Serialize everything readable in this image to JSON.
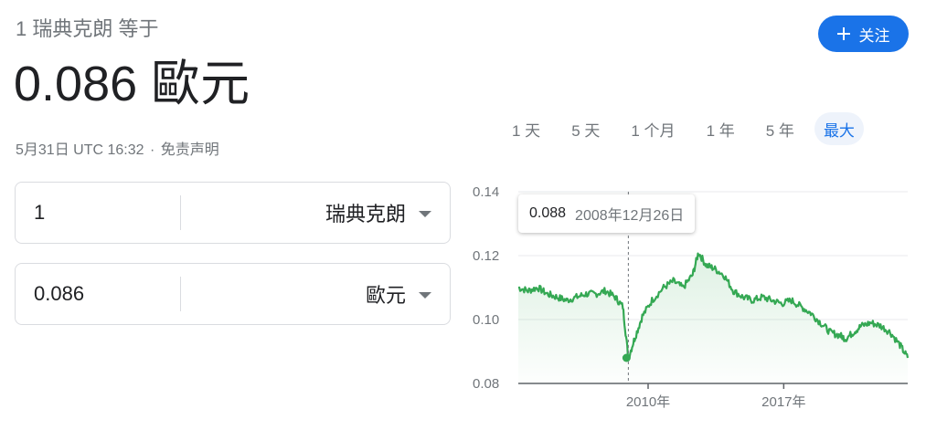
{
  "header": {
    "equals_text": "1 瑞典克朗 等于",
    "big_value": "0.086 歐元",
    "date_text": "5月31日 UTC 16:32",
    "separator": "·",
    "disclaimer": "免责声明"
  },
  "follow_button": {
    "label": "关注",
    "icon": "plus-icon"
  },
  "range_tabs": [
    {
      "label": "1 天"
    },
    {
      "label": "5 天"
    },
    {
      "label": "1 个月"
    },
    {
      "label": "1 年"
    },
    {
      "label": "5 年"
    },
    {
      "label": "最大",
      "active": true
    }
  ],
  "converter": {
    "from": {
      "amount": "1",
      "currency": "瑞典克朗"
    },
    "to": {
      "amount": "0.086",
      "currency": "歐元"
    }
  },
  "tooltip": {
    "value": "0.088",
    "date": "2008年12月26日"
  },
  "colors": {
    "accent": "#1a73e8",
    "line": "#34a853",
    "grid": "#e8eaed",
    "text_muted": "#70757a"
  },
  "chart_data": {
    "type": "line",
    "ylim": [
      0.08,
      0.14
    ],
    "y_ticks": [
      {
        "value": 0.14,
        "label": "0.14"
      },
      {
        "value": 0.12,
        "label": "0.12"
      },
      {
        "value": 0.1,
        "label": "0.10"
      },
      {
        "value": 0.08,
        "label": "0.08"
      }
    ],
    "xlim": [
      2003.3,
      2023.4
    ],
    "x_ticks": [
      {
        "value": 2010,
        "label": "2010年"
      },
      {
        "value": 2017,
        "label": "2017年"
      }
    ],
    "grid": true,
    "series": [
      {
        "x": [
          2003.3,
          2003.8,
          2004.3,
          2004.8,
          2005.3,
          2005.8,
          2006.3,
          2006.8,
          2007.3,
          2007.8,
          2008.3,
          2008.7,
          2008.98,
          2009.3,
          2009.7,
          2010.2,
          2010.8,
          2011.3,
          2011.8,
          2012.3,
          2012.6,
          2013.0,
          2013.4,
          2013.9,
          2014.4,
          2014.9,
          2015.4,
          2015.9,
          2016.4,
          2016.9,
          2017.4,
          2017.9,
          2018.4,
          2018.9,
          2019.4,
          2019.9,
          2020.2,
          2020.6,
          2021.0,
          2021.5,
          2022.0,
          2022.5,
          2023.0,
          2023.4
        ],
        "y": [
          0.11,
          0.109,
          0.11,
          0.108,
          0.107,
          0.106,
          0.107,
          0.108,
          0.108,
          0.109,
          0.107,
          0.104,
          0.088,
          0.094,
          0.101,
          0.106,
          0.11,
          0.112,
          0.11,
          0.114,
          0.121,
          0.117,
          0.116,
          0.114,
          0.109,
          0.107,
          0.106,
          0.107,
          0.106,
          0.105,
          0.106,
          0.104,
          0.102,
          0.099,
          0.096,
          0.095,
          0.094,
          0.096,
          0.098,
          0.099,
          0.098,
          0.096,
          0.092,
          0.088
        ]
      }
    ],
    "highlight": {
      "x": 2008.98,
      "y": 0.088
    }
  }
}
